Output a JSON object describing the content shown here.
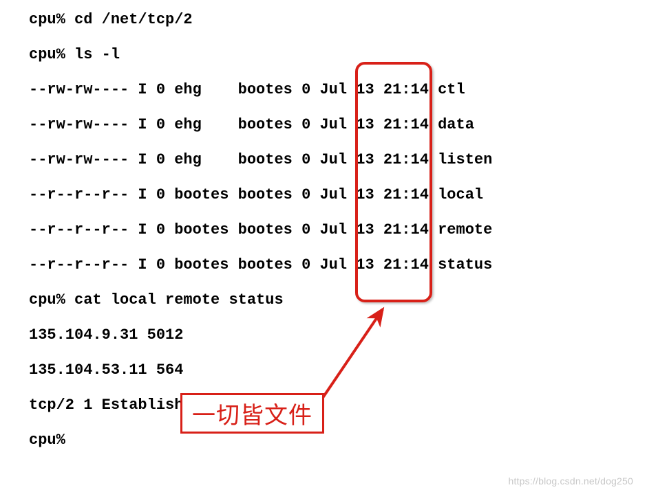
{
  "lines": [
    "cpu% cd /net/tcp/2",
    "cpu% ls -l",
    "--rw-rw---- I 0 ehg    bootes 0 Jul 13 21:14 ctl",
    "--rw-rw---- I 0 ehg    bootes 0 Jul 13 21:14 data",
    "--rw-rw---- I 0 ehg    bootes 0 Jul 13 21:14 listen",
    "--r--r--r-- I 0 bootes bootes 0 Jul 13 21:14 local",
    "--r--r--r-- I 0 bootes bootes 0 Jul 13 21:14 remote",
    "--r--r--r-- I 0 bootes bootes 0 Jul 13 21:14 status",
    "cpu% cat local remote status",
    "135.104.9.31 5012",
    "135.104.53.11 564",
    "tcp/2 1 Established connect",
    "cpu%"
  ],
  "label": "一切皆文件",
  "watermark": "https://blog.csdn.net/dog250"
}
